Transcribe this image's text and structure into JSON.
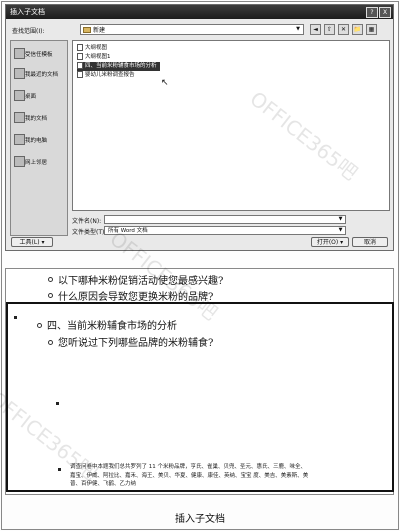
{
  "dialog": {
    "title": "插入子文档",
    "help": "?",
    "close": "X",
    "lookin_label": "查找范围(I):",
    "lookin_value": "新建",
    "toolbar_icons": [
      "◄",
      "⇧",
      "✕",
      "📁",
      "▦"
    ],
    "places": [
      {
        "label": "受信任模板"
      },
      {
        "label": "我最近的文档"
      },
      {
        "label": "桌面"
      },
      {
        "label": "我的文档"
      },
      {
        "label": "我的电脑"
      },
      {
        "label": "网上邻居"
      }
    ],
    "files": [
      {
        "name": "大纲视图"
      },
      {
        "name": "大纲视图1"
      },
      {
        "name": "四、当前米粉辅食市场的分析",
        "selected": true
      },
      {
        "name": "婴幼儿米粉调查报告"
      }
    ],
    "filename_label": "文件名(N):",
    "filename_value": "",
    "filetype_label": "文件类型(T):",
    "filetype_value": "所有 Word 文档",
    "tools_label": "工具(L) ▾",
    "open_label": "打开(O) ▾",
    "cancel_label": "取消"
  },
  "outline": {
    "line1": "以下哪种米粉促销活动使您最感兴趣?",
    "line2": "什么原因会导致您更换米粉的品牌?",
    "heading": "四、当前米粉辅食市场的分析",
    "line3": "您听说过下列哪些品牌的米粉辅食?",
    "paragraph": "调查问卷中本题我们总共罗列了 11 个米粉品牌，亨氏、雀巢、贝兜、圣元、惠氏、三鹿、味全、嘉宝、伊威、阿拉比、嘉禾、海王、美贝、华夏、健康、康佳、英纳、宝宝 度、美吉、美素斯、美普、百伊健、飞鹤、乙力纳"
  },
  "caption": "插入子文档",
  "watermark": "OFFICE365吧"
}
